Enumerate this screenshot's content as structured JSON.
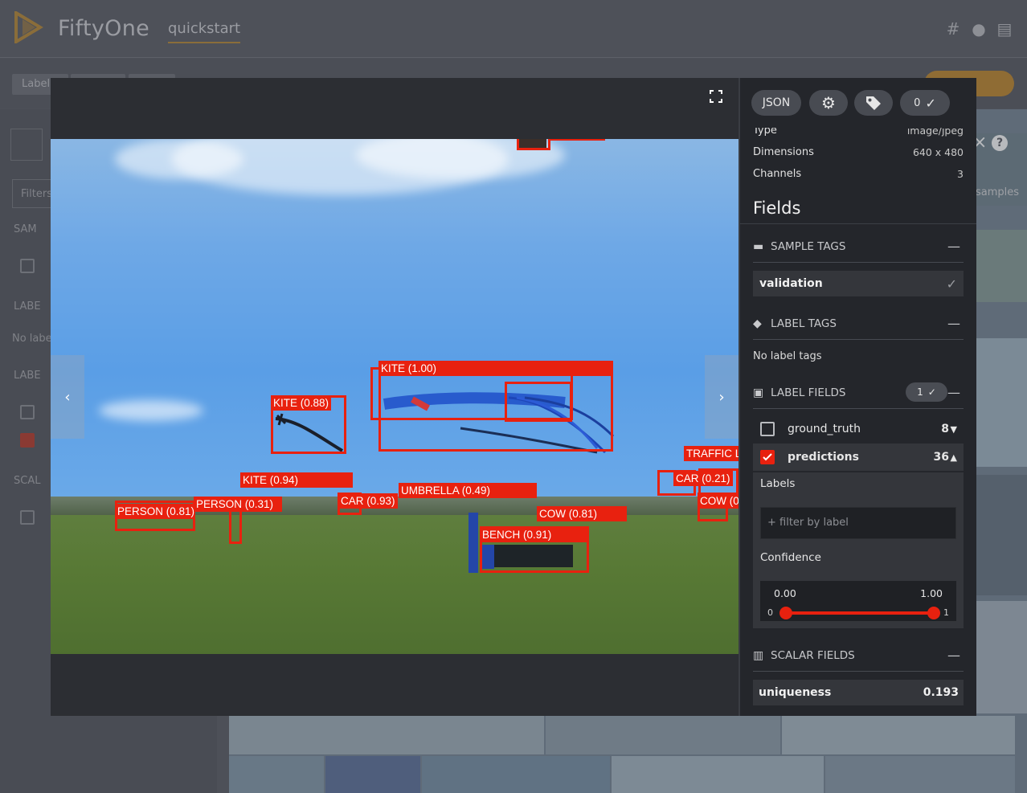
{
  "app": {
    "name": "FiftyOne",
    "dataset": "quickstart"
  },
  "background": {
    "tab_labels": "Label",
    "filters_placeholder": "Filters",
    "sidebar_samples": "SAM",
    "sidebar_labels": "LABE",
    "no_labels": "No label",
    "sidebar_labels2": "LABE",
    "sidebar_scalars": "SCAL",
    "samples_text": "samples"
  },
  "modal": {
    "buttons": {
      "json": "JSON",
      "selected_count": "0"
    },
    "metadata": [
      {
        "key": "Type",
        "value": "image/jpeg"
      },
      {
        "key": "Dimensions",
        "value": "640 x 480"
      },
      {
        "key": "Channels",
        "value": "3"
      }
    ],
    "fields_title": "Fields",
    "sample_tags": {
      "header": "SAMPLE TAGS",
      "tags": [
        "validation"
      ]
    },
    "label_tags": {
      "header": "LABEL TAGS",
      "empty_text": "No label tags"
    },
    "label_fields": {
      "header": "LABEL FIELDS",
      "badge_count": "1",
      "fields": [
        {
          "name": "ground_truth",
          "count": "8",
          "checked": false,
          "expanded": false
        },
        {
          "name": "predictions",
          "count": "36",
          "checked": true,
          "expanded": true
        }
      ],
      "labels_heading": "Labels",
      "filter_placeholder": "+ filter by label",
      "confidence_heading": "Confidence",
      "confidence_min": "0.00",
      "confidence_max": "1.00",
      "tick_min": "0",
      "tick_max": "1",
      "confidence_range": [
        0.0,
        1.0
      ]
    },
    "scalar_fields": {
      "header": "SCALAR FIELDS",
      "rows": [
        {
          "name": "uniqueness",
          "value": "0.193"
        }
      ]
    },
    "detections": [
      {
        "label": "KITE (1.00)"
      },
      {
        "label": "KITE (0.88)"
      },
      {
        "label": "KITE (0.94)"
      },
      {
        "label": "PERSON (0.81)"
      },
      {
        "label": "PERSON (0.31)"
      },
      {
        "label": "CAR (0.93)"
      },
      {
        "label": "UMBRELLA (0.49)"
      },
      {
        "label": "COW (0.81)"
      },
      {
        "label": "BENCH (0.91)"
      },
      {
        "label": "TRAFFIC L"
      },
      {
        "label": "CAR (0.21)"
      },
      {
        "label": "COW (0"
      }
    ],
    "detection_color": "#e8210f"
  },
  "colors": {
    "accent": "#e8210f",
    "panel_bg": "#24262b"
  }
}
